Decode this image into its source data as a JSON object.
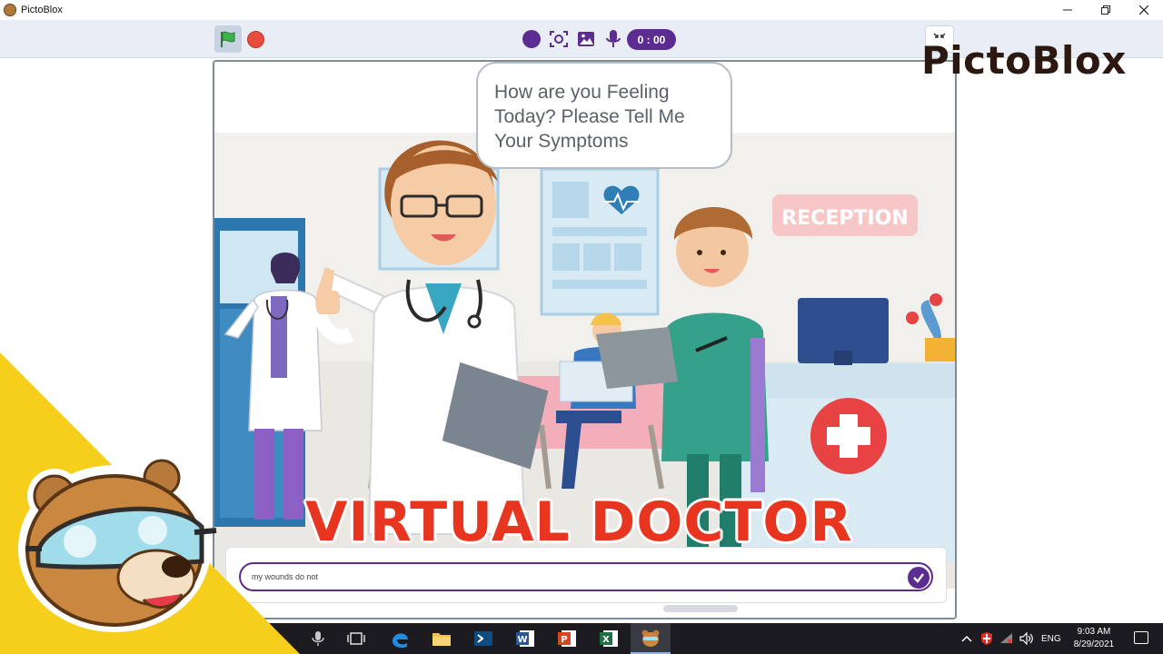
{
  "window": {
    "title": "PictoBlox",
    "controls": [
      "minimize",
      "restore",
      "close"
    ]
  },
  "toolbar": {
    "green_flag": "green-flag-icon",
    "stop": "stop-icon",
    "timer": "0 : 00",
    "icons": [
      "record-icon",
      "screenshot-icon",
      "image-icon",
      "microphone-icon"
    ]
  },
  "brand": {
    "name": "PictoBlox"
  },
  "stage": {
    "speech_bubble": "How are you Feeling Today? Please Tell Me Your Symptoms",
    "sign": "RECEPTION",
    "answer_input": "my wounds do not"
  },
  "overlay": {
    "title": "VIRTUAL DOCTOR"
  },
  "colors": {
    "accent_purple": "#5c2d91",
    "stop_red": "#e84c3d",
    "flag_green": "#3bb34a",
    "overlay_red": "#e8351f",
    "corner_yellow": "#f6cf1c",
    "taskbar": "#1b1b20"
  },
  "taskbar": {
    "apps": [
      "microphone-icon",
      "task-view-icon",
      "edge-icon",
      "file-explorer-icon",
      "terminal-icon",
      "word-icon",
      "powerpoint-icon",
      "excel-icon",
      "pictoblox-icon"
    ],
    "tray": {
      "language": "ENG",
      "time": "9:03 AM",
      "date": "8/29/2021"
    }
  }
}
